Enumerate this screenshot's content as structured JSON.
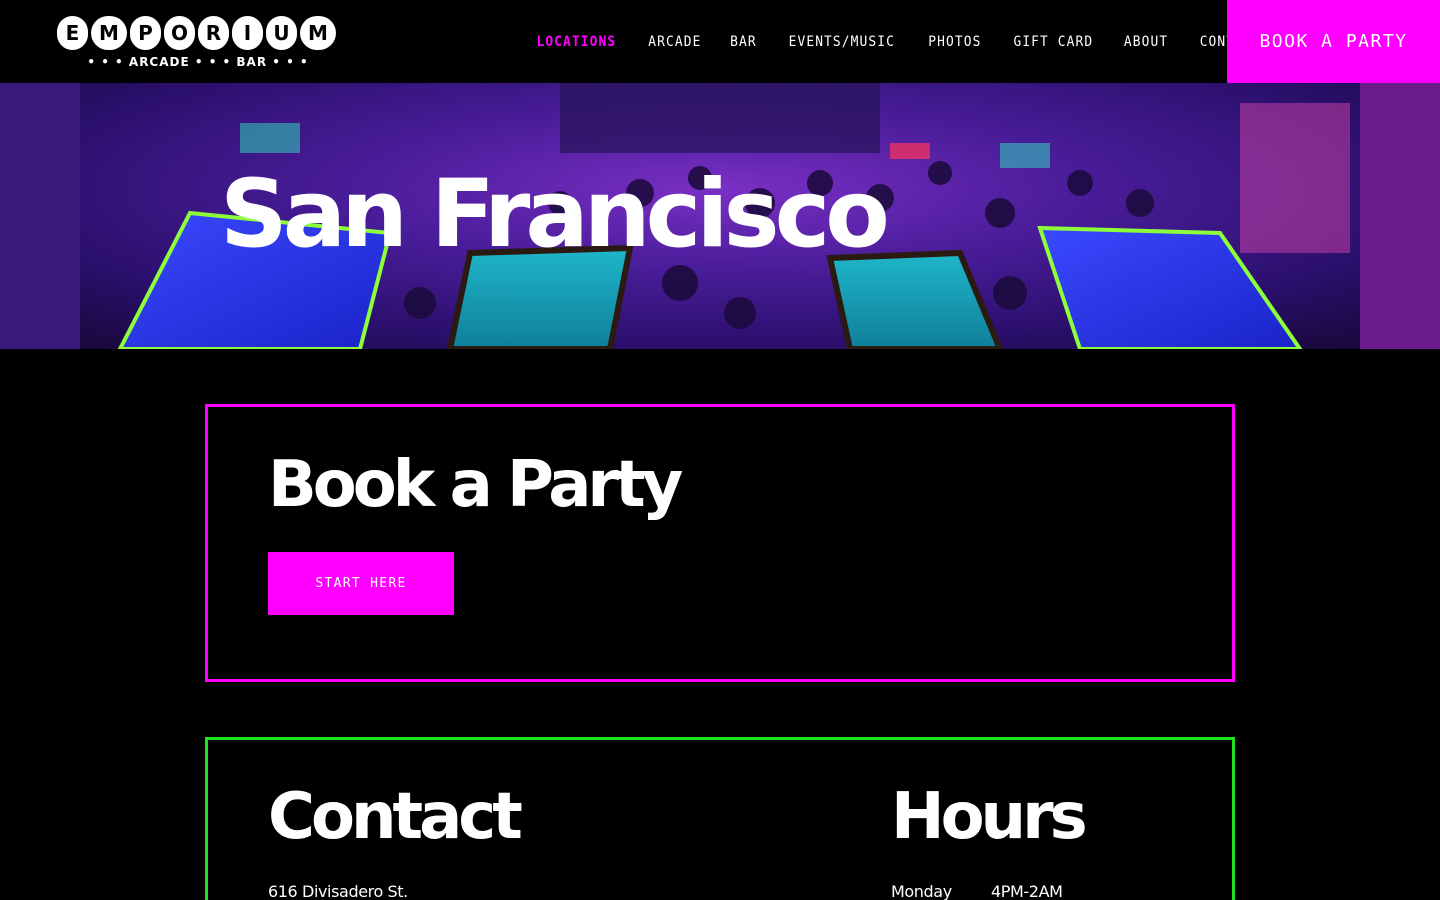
{
  "brand": {
    "letters": [
      "E",
      "M",
      "P",
      "O",
      "R",
      "I",
      "U",
      "M"
    ],
    "tagline": "• • • ARCADE • • • BAR • • •"
  },
  "nav": {
    "items": [
      {
        "label": "LOCATIONS",
        "active": true
      },
      {
        "label": "ARCADE"
      },
      {
        "label": "BAR"
      },
      {
        "label": "EVENTS/MUSIC"
      },
      {
        "label": "PHOTOS"
      },
      {
        "label": "GIFT CARD"
      },
      {
        "label": "ABOUT"
      },
      {
        "label": "CONTACT"
      }
    ],
    "cta": "BOOK A PARTY"
  },
  "hero": {
    "title": "San Francisco"
  },
  "party": {
    "heading": "Book a Party",
    "button": "START HERE"
  },
  "contact": {
    "heading": "Contact",
    "address": "616 Divisadero St."
  },
  "hours": {
    "heading": "Hours",
    "rows": [
      {
        "day": "Monday",
        "time": "4PM-2AM"
      }
    ]
  },
  "colors": {
    "accent": "#ff00ff",
    "green": "#22e022",
    "background": "#000000"
  }
}
